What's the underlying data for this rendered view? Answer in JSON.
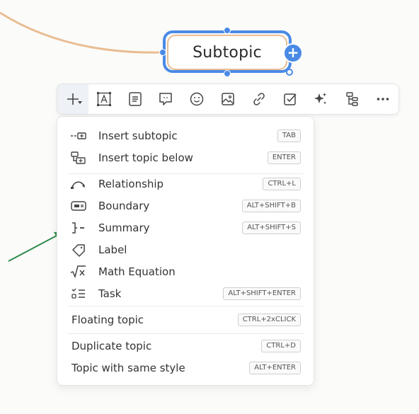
{
  "node": {
    "label": "Subtopic"
  },
  "toolbar": {
    "buttons": [
      {
        "name": "add-icon",
        "caret": true
      },
      {
        "name": "text-style-icon"
      },
      {
        "name": "note-icon"
      },
      {
        "name": "comment-icon"
      },
      {
        "name": "emoji-icon"
      },
      {
        "name": "image-icon"
      },
      {
        "name": "link-icon"
      },
      {
        "name": "task-checkbox-icon"
      },
      {
        "name": "ai-sparkle-icon"
      },
      {
        "name": "structure-icon"
      },
      {
        "name": "more-icon"
      }
    ]
  },
  "menu": {
    "items": [
      {
        "label": "Insert subtopic",
        "shortcut": "TAB",
        "icon": "insert-subtopic-icon"
      },
      {
        "label": "Insert topic below",
        "shortcut": "ENTER",
        "icon": "insert-topic-below-icon"
      },
      {
        "label": "Relationship",
        "shortcut": "CTRL+L",
        "icon": "relationship-icon"
      },
      {
        "label": "Boundary",
        "shortcut": "ALT+SHIFT+B",
        "icon": "boundary-icon"
      },
      {
        "label": "Summary",
        "shortcut": "ALT+SHIFT+S",
        "icon": "summary-icon"
      },
      {
        "label": "Label",
        "shortcut": "",
        "icon": "label-tag-icon"
      },
      {
        "label": "Math Equation",
        "shortcut": "",
        "icon": "math-equation-icon"
      },
      {
        "label": "Task",
        "shortcut": "ALT+SHIFT+ENTER",
        "icon": "task-list-icon"
      },
      {
        "label": "Floating topic",
        "shortcut": "CTRL+2xCLICK",
        "icon": ""
      },
      {
        "label": "Duplicate topic",
        "shortcut": "CTRL+D",
        "icon": ""
      },
      {
        "label": "Topic with same style",
        "shortcut": "ALT+ENTER",
        "icon": ""
      }
    ]
  },
  "colors": {
    "selection_blue": "#4a8ae6",
    "connector_orange": "#e9bd92",
    "annotation_arrow_green": "#2e8b4a"
  }
}
